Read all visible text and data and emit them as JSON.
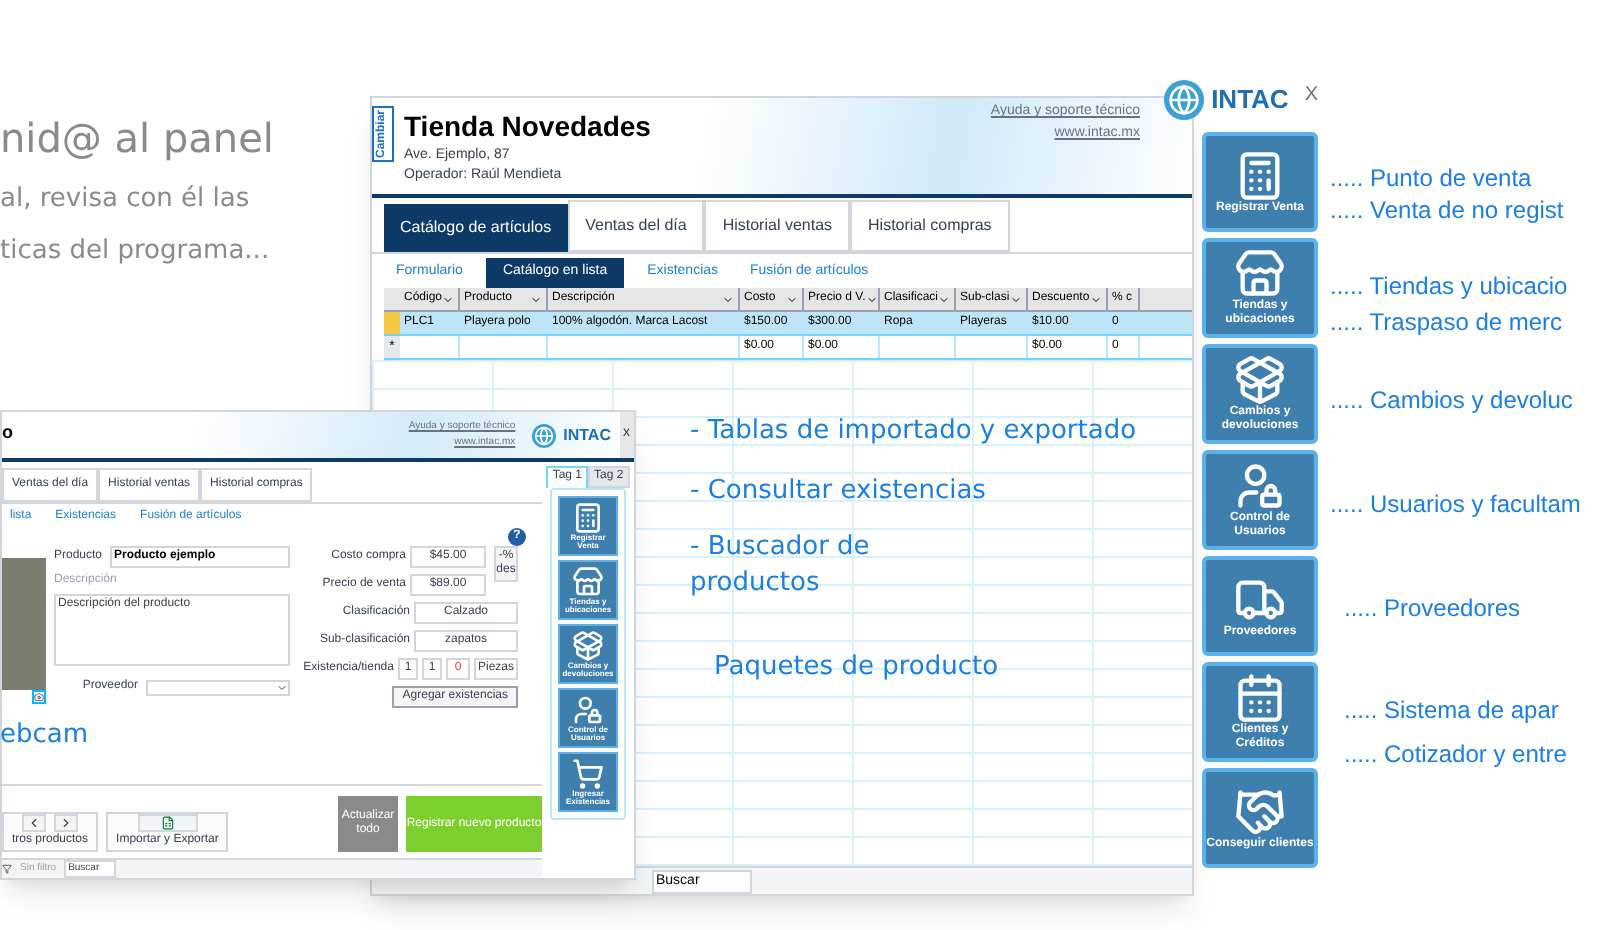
{
  "intro": [
    "nid@ al panel",
    "al, revisa con él las",
    "ticas del programa..."
  ],
  "main_window": {
    "switch_tab": "Cambiar",
    "title": "Tienda Novedades",
    "address": "Ave. Ejemplo, 87",
    "operator": "Operador: Raúl Mendieta",
    "help_link": "Ayuda y soporte técnico",
    "website": "www.intac.mx",
    "logo": "INTAC",
    "close": "X",
    "tabs": [
      {
        "label": "Catálogo de artículos",
        "selected": true
      },
      {
        "label": "Ventas del día",
        "selected": false
      },
      {
        "label": "Historial ventas",
        "selected": false
      },
      {
        "label": "Historial compras",
        "selected": false
      }
    ],
    "subtabs": [
      {
        "label": "Formulario",
        "selected": false
      },
      {
        "label": "Catálogo en lista",
        "selected": true
      },
      {
        "label": "Existencias",
        "selected": false
      },
      {
        "label": "Fusión de artículos",
        "selected": false
      }
    ],
    "table": {
      "columns": [
        "Código",
        "Producto",
        "Descripción",
        "Costo",
        "Precio d V.",
        "Clasificaci",
        "Sub-clasi",
        "Descuento",
        "% c"
      ],
      "rows": [
        {
          "selected": true,
          "cells": [
            "PLC1",
            "Playera polo",
            "100% algodón. Marca Lacost",
            "$150.00",
            "$300.00",
            "Ropa",
            "Playeras",
            "$10.00",
            "0"
          ]
        },
        {
          "selected": false,
          "marker": "*",
          "cells": [
            null,
            null,
            null,
            "$0.00",
            "$0.00",
            null,
            null,
            "$0.00",
            "0"
          ]
        }
      ]
    },
    "search_placeholder": "Buscar",
    "sidebar": [
      "Registrar Venta",
      "Tiendas y ubicaciones",
      "Cambios y devoluciones",
      "Control de Usuarios",
      "Proveedores",
      "Clientes y Créditos",
      "Conseguir clientes"
    ]
  },
  "feature_labels": [
    "..... Punto de venta",
    "..... Venta de no regist",
    "..... Tiendas y ubicacio",
    "..... Traspaso de merc",
    "..... Cambios y devoluc",
    "..... Usuarios y facultam",
    "..... Proveedores",
    "..... Sistema de apar",
    "..... Cotizador y entre"
  ],
  "notes": [
    "- Tablas de importado y exportado",
    "- Consultar existencias",
    "- Buscador de productos",
    "Paquetes de producto",
    "ebcam"
  ],
  "product_window": {
    "title": "o",
    "help_link": "Ayuda y soporte técnico",
    "website": "www.intac.mx",
    "logo": "INTAC",
    "close": "x",
    "tabs": [
      {
        "label": "Ventas del día",
        "selected": false
      },
      {
        "label": "Historial ventas",
        "selected": false
      },
      {
        "label": "Historial compras",
        "selected": false
      }
    ],
    "tag_tabs": [
      {
        "label": "Tag 1",
        "selected": true
      },
      {
        "label": "Tag 2",
        "selected": false
      }
    ],
    "subtabs": [
      "lista",
      "Existencias",
      "Fusión de artículos"
    ],
    "help": "?",
    "form": {
      "product_label": "Producto",
      "product_value": "Producto ejemplo",
      "description_label": "Descripción",
      "description_value": "Descripción del producto",
      "supplier_label": "Proveedor",
      "cost_label": "Costo compra",
      "cost_value": "$45.00",
      "price_label": "Precio de venta",
      "price_value": "$89.00",
      "discount_button": "-% des",
      "class_label": "Clasificación",
      "class_value": "Calzado",
      "subclass_label": "Sub-clasificación",
      "subclass_value": "zapatos",
      "stock_label": "Existencia/tienda",
      "stock_values": [
        "1",
        "1",
        "0"
      ],
      "stock_unit": "Piezas",
      "add_stock": "Agregar existencias"
    },
    "footer": {
      "other_products": "tros productos",
      "import_export": "Importar y Exportar",
      "update_all": "Actualizar todo",
      "register": "Registrar nuevo producto"
    },
    "status": {
      "filter": "Sin filtro",
      "search": "Buscar"
    },
    "sidebar": [
      "Registrar Venta",
      "Tiendas y ubicaciones",
      "Cambios y devoluciones",
      "Control de Usuarios",
      "Ingresar Existencias"
    ]
  }
}
